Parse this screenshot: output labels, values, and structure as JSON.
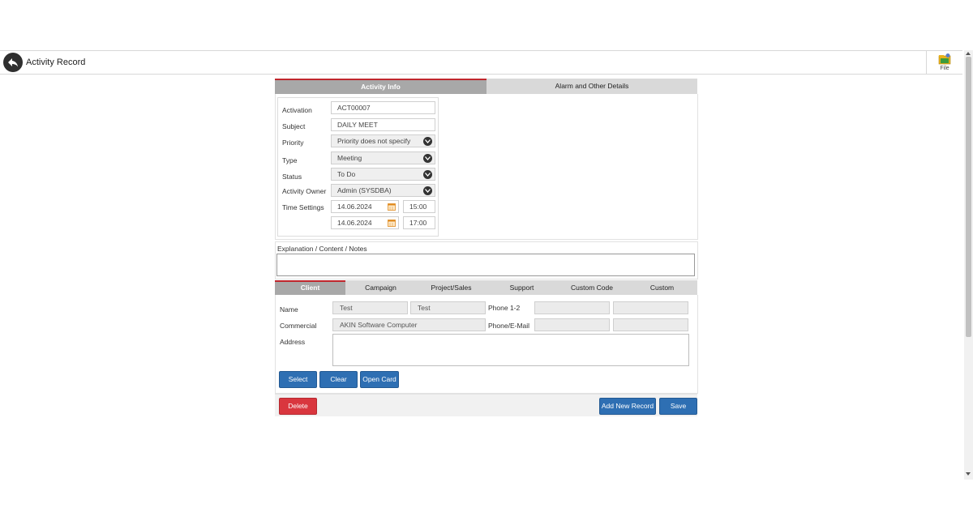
{
  "header": {
    "title": "Activity Record",
    "file_label": "File"
  },
  "top_tabs": [
    {
      "label": "Activity Info",
      "active": true
    },
    {
      "label": "Alarm and Other Details",
      "active": false
    }
  ],
  "form": {
    "activation": {
      "label": "Activation",
      "value": "ACT00007"
    },
    "subject": {
      "label": "Subject",
      "value": "DAILY MEET"
    },
    "priority": {
      "label": "Priority",
      "value": "Priority does not specify"
    },
    "type": {
      "label": "Type",
      "value": "Meeting"
    },
    "status": {
      "label": "Status",
      "value": "To Do"
    },
    "owner": {
      "label": "Activity Owner",
      "value": "Admin  (SYSDBA)"
    },
    "time": {
      "label": "Time Settings",
      "start_date": "14.06.2024",
      "start_time": "15:00",
      "end_date": "14.06.2024",
      "end_time": "17:00"
    }
  },
  "notes": {
    "label": "Explanation / Content / Notes",
    "value": ""
  },
  "sub_tabs": [
    {
      "label": "Client",
      "active": true
    },
    {
      "label": "Campaign",
      "active": false
    },
    {
      "label": "Project/Sales",
      "active": false
    },
    {
      "label": "Support",
      "active": false
    },
    {
      "label": "Custom Code",
      "active": false
    },
    {
      "label": "Custom",
      "active": false
    }
  ],
  "client": {
    "name_label": "Name",
    "name_first": "Test",
    "name_last": "Test",
    "commercial_label": "Commercial",
    "commercial_value": "AKIN Software Computer",
    "address_label": "Address",
    "address_value": "",
    "phone12_label": "Phone 1-2",
    "phone_email_label": "Phone/E-Mail",
    "phone1": "",
    "phone2": "",
    "phone3": "",
    "email": ""
  },
  "client_buttons": {
    "select": "Select",
    "clear": "Clear",
    "open_card": "Open Card"
  },
  "footer_buttons": {
    "delete": "Delete",
    "add_new": "Add New Record",
    "save": "Save"
  },
  "colors": {
    "accent_red": "#c0272d",
    "button_blue": "#2e6fb3",
    "button_red": "#d9363e"
  }
}
